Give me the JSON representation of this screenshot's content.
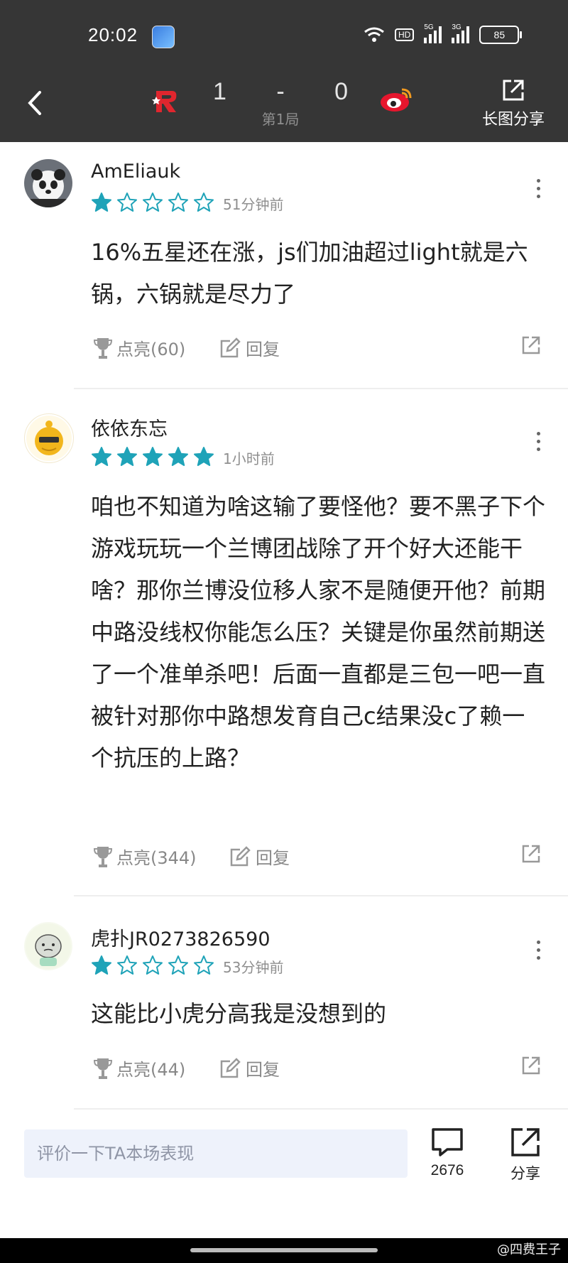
{
  "status": {
    "time": "20:02",
    "battery": "85",
    "network_labels": [
      "5G",
      "3G"
    ],
    "hd_label": "HD"
  },
  "header": {
    "score_left": "1",
    "score_sep": "-",
    "score_right": "0",
    "round": "第1局",
    "share_label": "长图分享"
  },
  "comments": [
    {
      "username": "AmEliauk",
      "stars": 1,
      "time_ago": "51分钟前",
      "text": "16%五星还在涨，js们加油超过light就是六锅，六锅就是尽力了",
      "like_label": "点亮(60)",
      "reply_label": "回复"
    },
    {
      "username": "依依东忘",
      "stars": 5,
      "time_ago": "1小时前",
      "text": "咱也不知道为啥这输了要怪他？要不黑子下个游戏玩玩一个兰博团战除了开个好大还能干啥？那你兰博没位移人家不是随便开他？前期中路没线权你能怎么压？关键是你虽然前期送了一个准单杀吧！后面一直都是三包一吧一直被针对那你中路想发育自己c结果没c了赖一个抗压的上路？",
      "like_label": "点亮(344)",
      "reply_label": "回复"
    },
    {
      "username": "虎扑JR0273826590",
      "stars": 1,
      "time_ago": "53分钟前",
      "text": "这能比小虎分高我是没想到的",
      "like_label": "点亮(44)",
      "reply_label": "回复"
    }
  ],
  "footer": {
    "input_placeholder": "评价一下TA本场表现",
    "comment_count": "2676",
    "share_label": "分享"
  },
  "watermark": "@四费王子",
  "colors": {
    "header_bg": "#363636",
    "star": "#1fa3b8",
    "muted": "#8f8f8f",
    "input_bg": "#eef2fb"
  }
}
